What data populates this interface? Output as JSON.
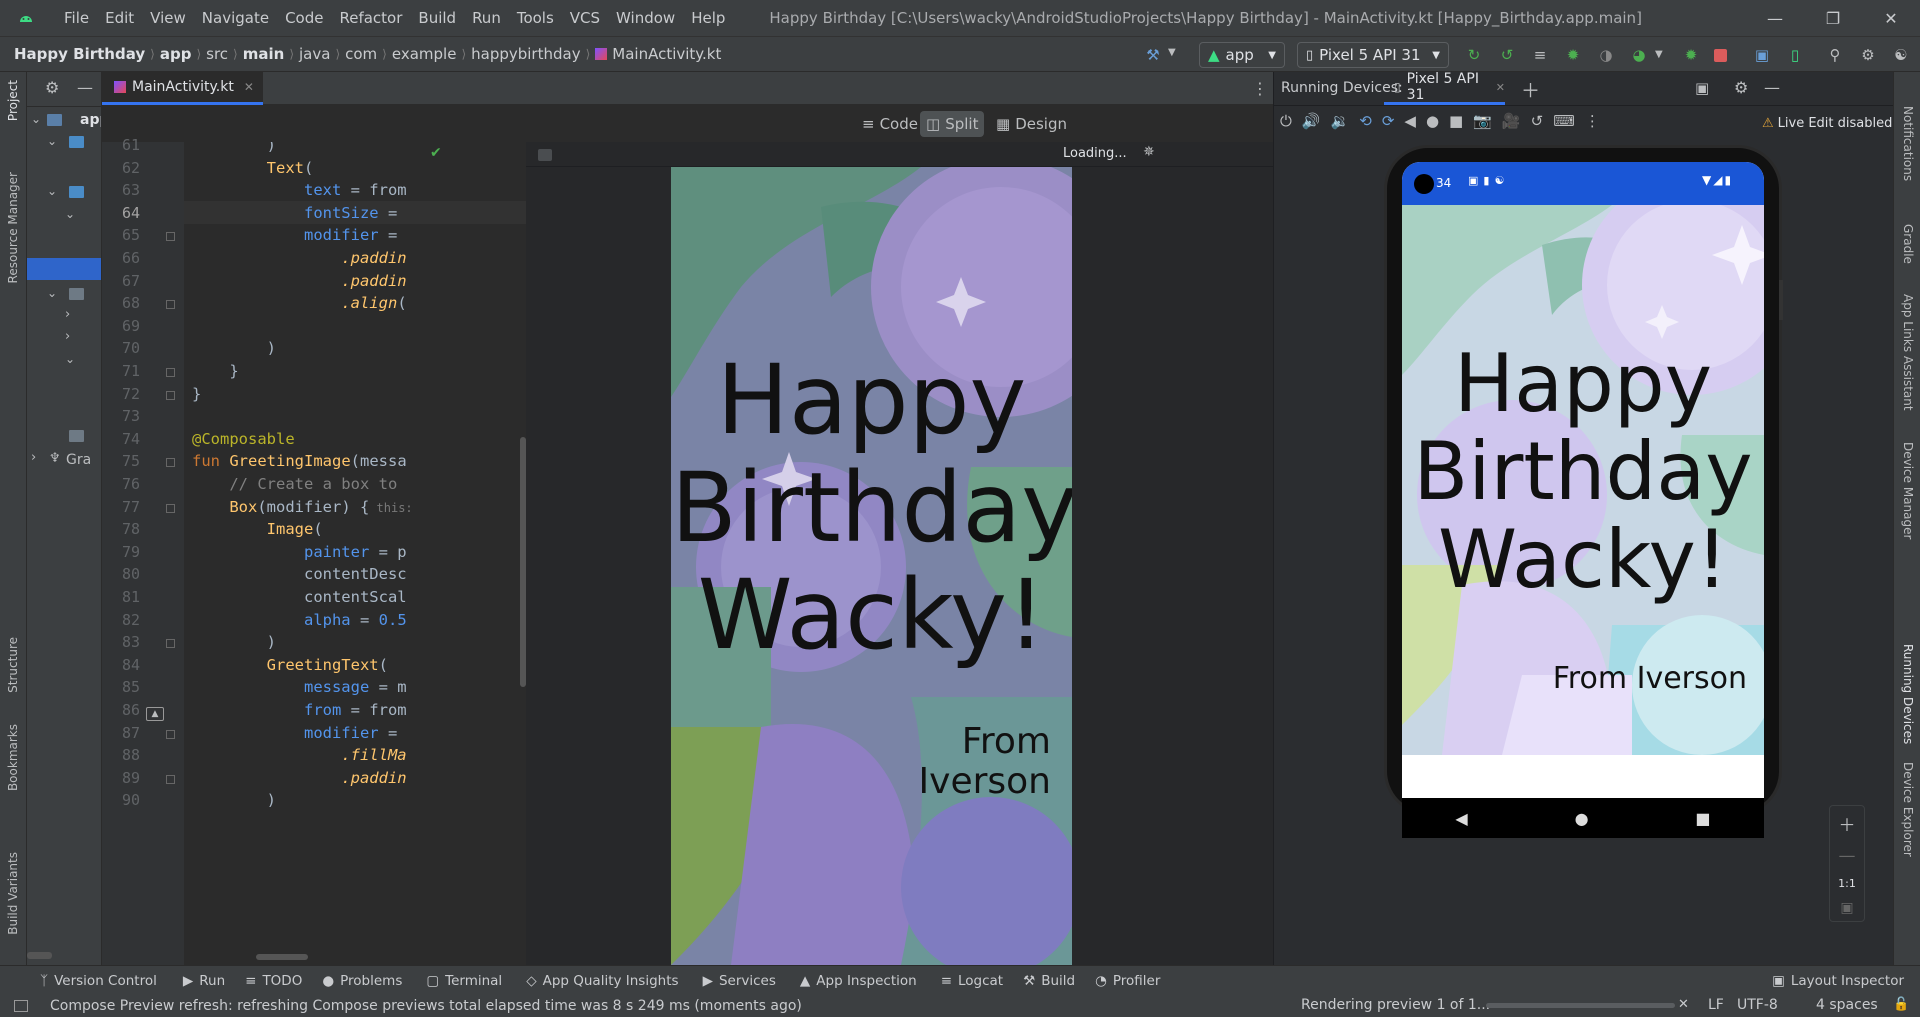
{
  "menu": [
    "File",
    "Edit",
    "View",
    "Navigate",
    "Code",
    "Refactor",
    "Build",
    "Run",
    "Tools",
    "VCS",
    "Window",
    "Help"
  ],
  "window_title": "Happy Birthday [C:\\Users\\wacky\\AndroidStudioProjects\\Happy Birthday] - MainActivity.kt [Happy_Birthday.app.main]",
  "breadcrumbs": [
    "Happy Birthday",
    "app",
    "src",
    "main",
    "java",
    "com",
    "example",
    "happybirthday",
    "MainActivity.kt"
  ],
  "run_config": "app",
  "device": "Pixel 5 API 31",
  "editor_tab": "MainActivity.kt",
  "view_modes": {
    "code": "Code",
    "split": "Split",
    "design": "Design"
  },
  "loading_label": "Loading...",
  "code_lines": [
    {
      "n": "61",
      "t": "        )"
    },
    {
      "n": "62",
      "t": "        Text("
    },
    {
      "n": "63",
      "t": "            text = from"
    },
    {
      "n": "64",
      "t": "            fontSize ="
    },
    {
      "n": "65",
      "t": "            modifier ="
    },
    {
      "n": "66",
      "t": "                .paddin"
    },
    {
      "n": "67",
      "t": "                .paddin"
    },
    {
      "n": "68",
      "t": "                .align("
    },
    {
      "n": "69",
      "t": ""
    },
    {
      "n": "70",
      "t": "        )"
    },
    {
      "n": "71",
      "t": "    }"
    },
    {
      "n": "72",
      "t": "}"
    },
    {
      "n": "73",
      "t": ""
    },
    {
      "n": "74",
      "t": "@Composable"
    },
    {
      "n": "75",
      "t": "fun GreetingImage(messa"
    },
    {
      "n": "76",
      "t": "    // Create a box to"
    },
    {
      "n": "77",
      "t": "    Box(modifier) {"
    },
    {
      "n": "78",
      "t": "        Image("
    },
    {
      "n": "79",
      "t": "            painter = p"
    },
    {
      "n": "80",
      "t": "            contentDesc"
    },
    {
      "n": "81",
      "t": "            contentScal"
    },
    {
      "n": "82",
      "t": "            alpha = 0.5"
    },
    {
      "n": "83",
      "t": "        )"
    },
    {
      "n": "84",
      "t": "        GreetingText("
    },
    {
      "n": "85",
      "t": "            message = m"
    },
    {
      "n": "86",
      "t": "            from = from"
    },
    {
      "n": "87",
      "t": "            modifier ="
    },
    {
      "n": "88",
      "t": "                .fillMa"
    },
    {
      "n": "89",
      "t": "                .paddin"
    },
    {
      "n": "90",
      "t": "        )"
    }
  ],
  "hint_this": "this:",
  "greeting": {
    "line1": "Happy",
    "line2": "Birthday",
    "line3": "Wacky!",
    "from": "From Iverson"
  },
  "running_devices": {
    "label": "Running Devices:",
    "tab": "Pixel 5 API 31",
    "live_edit": "Live Edit disabled",
    "status_time": "34",
    "zoom_ratio": "1:1"
  },
  "left_stripe": [
    "Project",
    "Resource Manager",
    "Structure",
    "Bookmarks",
    "Build Variants"
  ],
  "project_tree": [
    "app",
    "Gra"
  ],
  "right_stripe": [
    "Notifications",
    "Gradle",
    "App Links Assistant",
    "Device Manager",
    "Running Devices",
    "Device Explorer"
  ],
  "tool_windows": [
    "Version Control",
    "Run",
    "TODO",
    "Problems",
    "Terminal",
    "App Quality Insights",
    "Services",
    "App Inspection",
    "Logcat",
    "Build",
    "Profiler"
  ],
  "layout_inspector": "Layout Inspector",
  "status": {
    "message": "Compose Preview refresh: refreshing Compose previews total elapsed time was 8 s 249 ms (moments ago)",
    "rendering": "Rendering preview 1 of 1...",
    "line_sep": "LF",
    "encoding": "UTF-8",
    "indent": "4 spaces"
  },
  "colors": {
    "accent": "#3574f0",
    "android_green": "#3ddc84",
    "run_green": "#4caf50",
    "stop_red": "#db5c5c",
    "status_bar_blue": "#1a56d6"
  }
}
